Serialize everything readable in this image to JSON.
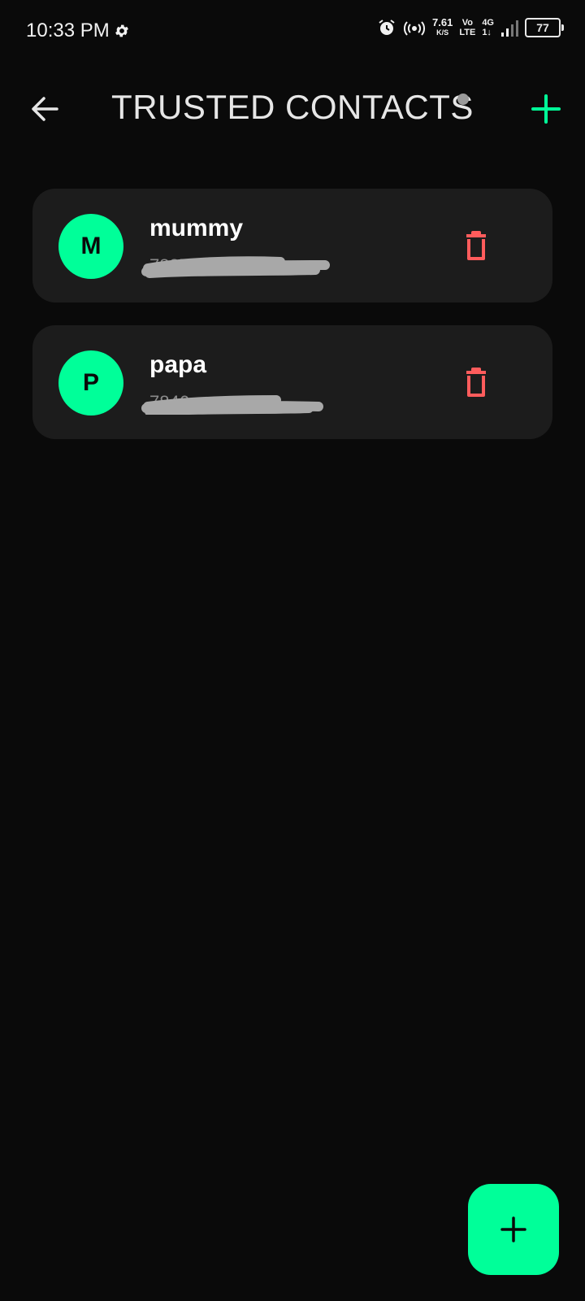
{
  "status_bar": {
    "time": "10:33 PM",
    "speed_value": "7.61",
    "speed_unit": "K/S",
    "volte_top": "Vo",
    "volte_bottom": "LTE",
    "network_top": "4G",
    "network_bottom": "1↓",
    "battery": "77",
    "icons": [
      "gear-icon",
      "alarm-icon",
      "hotspot-icon",
      "signal-icon",
      "battery-icon"
    ]
  },
  "header": {
    "title": "TRUSTED CONTACTS",
    "back_icon": "arrow-left-icon",
    "add_icon": "plus-icon"
  },
  "contacts": [
    {
      "initial": "M",
      "name": "mummy",
      "phone": "7887"
    },
    {
      "initial": "P",
      "name": "papa",
      "phone": "7846"
    }
  ],
  "colors": {
    "accent": "#00ff99",
    "background": "#0a0a0a",
    "card": "#1c1c1c",
    "delete": "#ff5c5c",
    "text_muted": "#8a8a8a"
  },
  "fab": {
    "icon": "plus-icon"
  }
}
